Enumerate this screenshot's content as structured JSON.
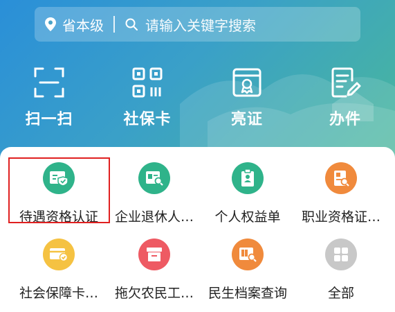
{
  "search": {
    "region": "省本级",
    "placeholder": "请输入关键字搜索"
  },
  "quick_actions": [
    {
      "label": "扫一扫",
      "icon": "scan-icon"
    },
    {
      "label": "社保卡",
      "icon": "qr-card-icon"
    },
    {
      "label": "亮证",
      "icon": "certificate-icon"
    },
    {
      "label": "办件",
      "icon": "document-edit-icon"
    }
  ],
  "services": [
    {
      "label": "待遇资格认证",
      "icon": "id-card-shield-icon",
      "color": "#2fb38a"
    },
    {
      "label": "企业退休人…",
      "icon": "id-card-search-icon",
      "color": "#2fb38a"
    },
    {
      "label": "个人权益单",
      "icon": "clipboard-person-icon",
      "color": "#2fb38a"
    },
    {
      "label": "职业资格证…",
      "icon": "certificate-search-icon",
      "color": "#f08a3c"
    },
    {
      "label": "社会保障卡…",
      "icon": "card-check-icon",
      "color": "#f5c242"
    },
    {
      "label": "拖欠农民工…",
      "icon": "archive-box-icon",
      "color": "#ee5a63"
    },
    {
      "label": "民生档案查询",
      "icon": "archive-search-icon",
      "color": "#f08a3c"
    },
    {
      "label": "全部",
      "icon": "grid-icon",
      "color": "#c8c8c8"
    }
  ],
  "highlight_color": "#e02020"
}
